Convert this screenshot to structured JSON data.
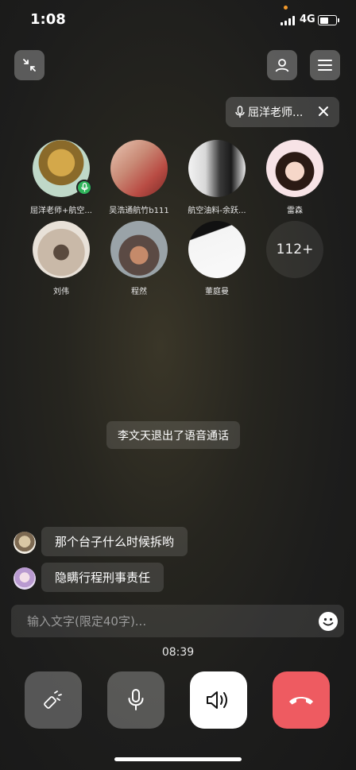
{
  "status_bar": {
    "time": "1:08",
    "network": "4G"
  },
  "speaker_chip": {
    "label": "屈洋老师..."
  },
  "participants": [
    {
      "name": "屈洋老师+航空..."
    },
    {
      "name": "吴浩通航竹b111"
    },
    {
      "name": "航空油料-余跃..."
    },
    {
      "name": "雷森"
    },
    {
      "name": "刘伟"
    },
    {
      "name": "程然"
    },
    {
      "name": "董庭曼"
    }
  ],
  "more_participants": "112+",
  "system_notice": "李文天退出了语音通话",
  "messages": [
    {
      "text": "那个台子什么时候拆哟"
    },
    {
      "text": "隐瞒行程刑事责任"
    }
  ],
  "input": {
    "placeholder": "输入文字(限定40字)..."
  },
  "call_timer": "08:39",
  "colors": {
    "hangup": "#ee5b61",
    "speaker_active": "#ffffff",
    "mic_badge": "#2fb35a"
  }
}
